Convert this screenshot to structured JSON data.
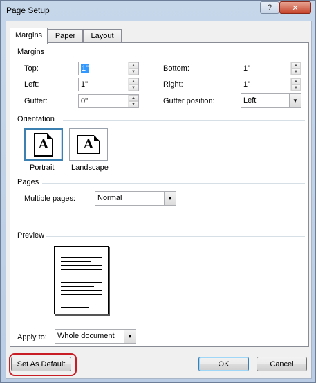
{
  "window": {
    "title": "Page Setup",
    "help_glyph": "?",
    "close_glyph": "✕"
  },
  "tabs": [
    {
      "label": "Margins",
      "active": true
    },
    {
      "label": "Paper",
      "active": false
    },
    {
      "label": "Layout",
      "active": false
    }
  ],
  "margins": {
    "group_label": "Margins",
    "top": {
      "label": "Top:",
      "value": "1\""
    },
    "bottom": {
      "label": "Bottom:",
      "value": "1\""
    },
    "left": {
      "label": "Left:",
      "value": "1\""
    },
    "right": {
      "label": "Right:",
      "value": "1\""
    },
    "gutter": {
      "label": "Gutter:",
      "value": "0\""
    },
    "gutter_position": {
      "label": "Gutter position:",
      "value": "Left"
    }
  },
  "orientation": {
    "group_label": "Orientation",
    "portrait_label": "Portrait",
    "landscape_label": "Landscape",
    "icon_letter": "A",
    "selected": "portrait"
  },
  "pages": {
    "group_label": "Pages",
    "multiple_pages_label": "Multiple pages:",
    "multiple_pages_value": "Normal"
  },
  "preview": {
    "group_label": "Preview"
  },
  "apply_to": {
    "label": "Apply to:",
    "value": "Whole document"
  },
  "buttons": {
    "set_default": "Set As Default",
    "ok": "OK",
    "cancel": "Cancel"
  },
  "colors": {
    "highlight_ring": "#c81d25",
    "selection": "#3399ff"
  }
}
